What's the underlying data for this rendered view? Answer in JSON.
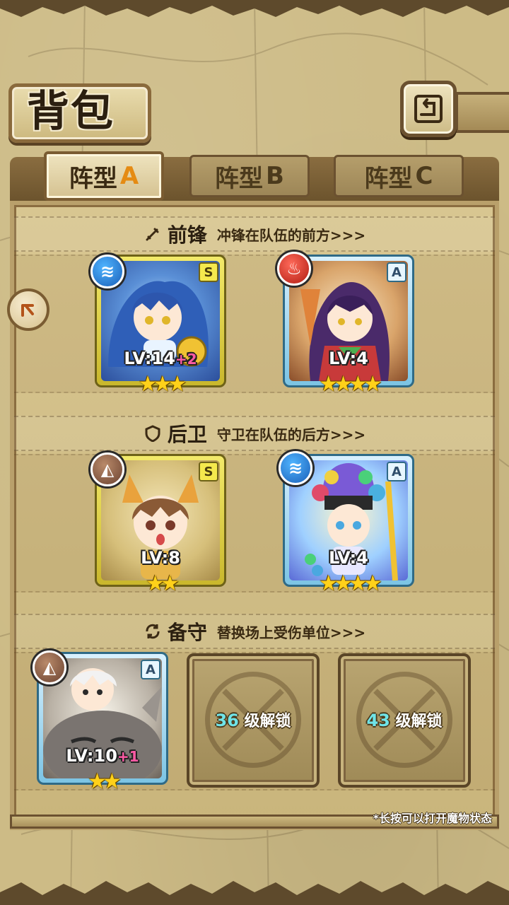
{
  "header": {
    "title": "背包",
    "back_icon": "back-arrow-icon"
  },
  "tabs": [
    {
      "label": "阵型",
      "suffix": "A",
      "active": true
    },
    {
      "label": "阵型",
      "suffix": "B",
      "active": false
    },
    {
      "label": "阵型",
      "suffix": "C",
      "active": false
    }
  ],
  "sections": {
    "front": {
      "icon": "sword-icon",
      "title": "前锋",
      "subtitle": "冲锋在队伍的前方>>>"
    },
    "rear": {
      "icon": "shield-icon",
      "title": "后卫",
      "subtitle": "守卫在队伍的后方>>>"
    },
    "reserve": {
      "icon": "swap-icon",
      "title": "备守",
      "subtitle": "替换场上受伤单位>>>"
    }
  },
  "cards": {
    "front1": {
      "element": "water",
      "rank": "S",
      "lv": "LV:14",
      "bonus": "+2",
      "stars": 3
    },
    "front2": {
      "element": "fire",
      "rank": "A",
      "lv": "LV:4",
      "bonus": "",
      "stars": 4
    },
    "rear1": {
      "element": "earth",
      "rank": "S",
      "lv": "LV:8",
      "bonus": "",
      "stars": 2
    },
    "rear2": {
      "element": "water",
      "rank": "A",
      "lv": "LV:4",
      "bonus": "",
      "stars": 4
    },
    "reserve1": {
      "element": "earth",
      "rank": "A",
      "lv": "LV:10",
      "bonus": "+1",
      "stars": 2
    }
  },
  "locked_slots": [
    {
      "level": "36",
      "text": "级解锁"
    },
    {
      "level": "43",
      "text": "级解锁"
    }
  ],
  "footer_note": "*长按可以打开魔物状态",
  "colors": {
    "parchment": "#cdbb86",
    "gold_frame": "#f3ea6a",
    "blue_frame": "#7cc4e4",
    "tab_accent": "#e58b13",
    "bonus_pink": "#ff5aa5",
    "unlock_cyan": "#6fe4e8"
  }
}
